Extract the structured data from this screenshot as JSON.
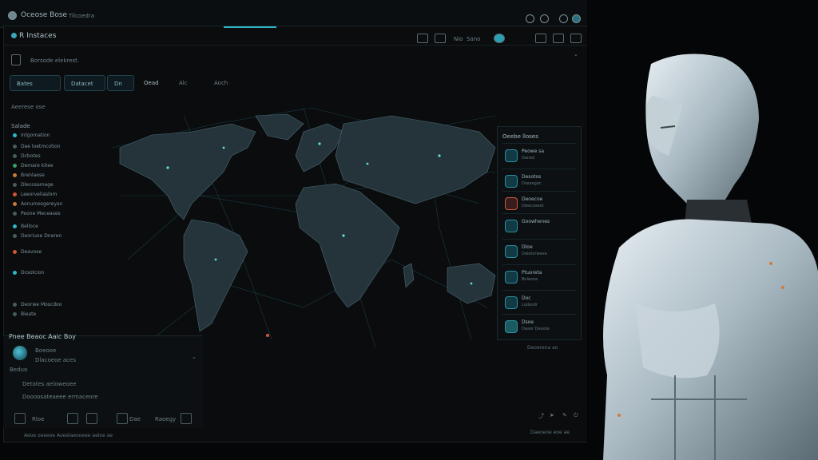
{
  "topbar": {
    "title": "Oceose Bose",
    "subtitle": "Tilcoedra"
  },
  "window": {
    "title": "R Instaces",
    "toolbar": [
      "Nio",
      "Sano"
    ],
    "breadcrumb": "Borsode elekrest.",
    "pills": [
      "Bates",
      "Datacet",
      "Dn"
    ],
    "tabs": [
      "Oead",
      "Alc",
      "Aoch"
    ]
  },
  "sidebar": {
    "header": "Aeerese ose",
    "section": "Salade",
    "items": [
      "Intgomation",
      "Dae loetmcotion",
      "Dcbotes",
      "Demare kitee",
      "Brenlaese",
      "Dlecosamage",
      "Leeorveliaslom",
      "Aonumesgereyan",
      "Peone Meceases",
      "Belloce",
      "Deoriuoe Dneren",
      "Deavose",
      "Dcsotcion",
      "Deorwe Moscdoo",
      "Bieate"
    ]
  },
  "right_panel": {
    "header": "Oeebe lloses",
    "cards": [
      {
        "title": "Peowe sa",
        "sub": "Daned"
      },
      {
        "title": "Desotos",
        "sub": "Dseoegoc"
      },
      {
        "title": "Deoecoe",
        "sub": "Dwecoseet"
      },
      {
        "title": "Goowhenes",
        "sub": ""
      },
      {
        "title": "Dloe",
        "sub": "Daletorweee"
      },
      {
        "title": "Ptuoreta",
        "sub": "Boleone"
      },
      {
        "title": "Doc",
        "sub": "Lodsodr"
      },
      {
        "title": "Dsoe",
        "sub": "Deaor Deeote"
      }
    ],
    "footer": "Deoerena ao"
  },
  "bottom_panel": {
    "header": "Pnee Beaoc Aaic Boy",
    "user_name": "Boeooe",
    "user_sub": "Dlacoeoe aces",
    "row_label": "Beduo",
    "line1": "Detotes aeloweoee",
    "line2": "Doooosateaeee ermaceore",
    "toolbar": [
      "Rloe",
      "Dae",
      "Raoegy"
    ]
  },
  "status": {
    "left": "Aeoe oeeeoe Aoeelaeooeee aeloe ae",
    "right": "Daeoeoe eoe ae"
  },
  "colors": {
    "accent": "#2fb7c9",
    "background": "#050607",
    "panel": "#0c1013"
  }
}
